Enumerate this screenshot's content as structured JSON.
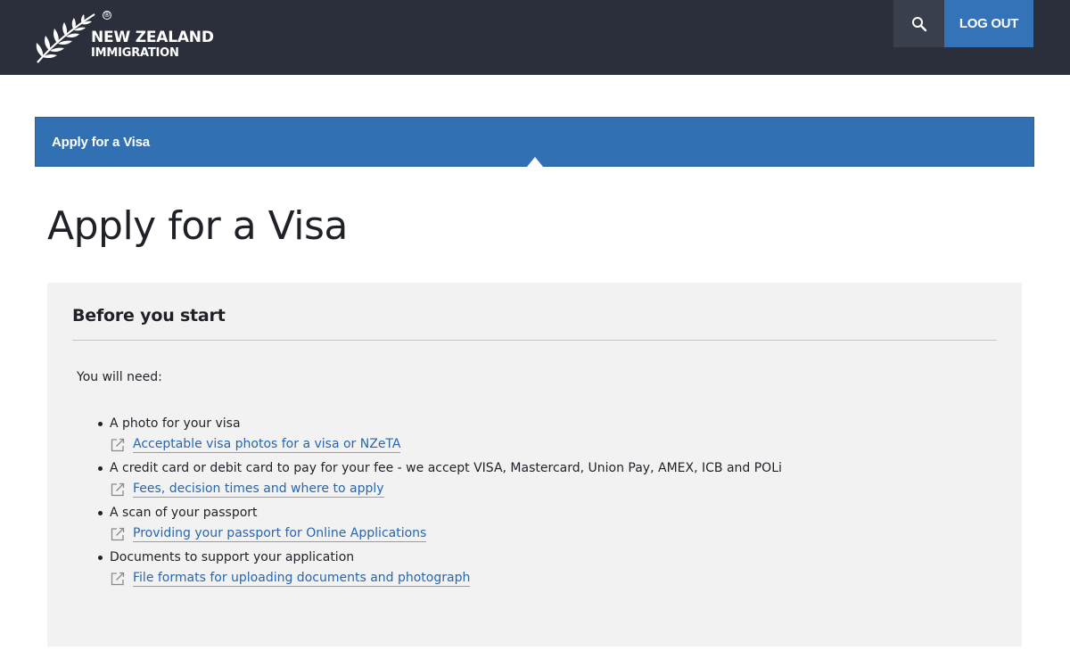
{
  "header": {
    "logo_line1": "NEW ZEALAND",
    "logo_line2": "IMMIGRATION",
    "logo_icon": "silver-fern-icon",
    "search_icon": "search-icon",
    "logout_label": "LOG OUT"
  },
  "breadcrumb": {
    "label": "Apply for a Visa"
  },
  "main": {
    "title": "Apply for a Visa",
    "panel": {
      "heading": "Before you start",
      "intro": "You will need:",
      "items": [
        {
          "text": "A photo for your visa",
          "link": "Acceptable visa photos for a visa or NZeTA"
        },
        {
          "text": "A credit card or debit card to pay for your fee - we accept VISA, Mastercard, Union Pay, AMEX, ICB and POLi",
          "link": "Fees, decision times and where to apply"
        },
        {
          "text": "A scan of your passport",
          "link": "Providing your passport for Online Applications"
        },
        {
          "text": "Documents to support your application",
          "link": "File formats for uploading documents and photograph"
        }
      ]
    }
  },
  "colors": {
    "header_bg": "#2b2f3b",
    "accent_blue": "#3070b3",
    "link_blue": "#2766ae",
    "panel_bg": "#f2f2f2"
  }
}
